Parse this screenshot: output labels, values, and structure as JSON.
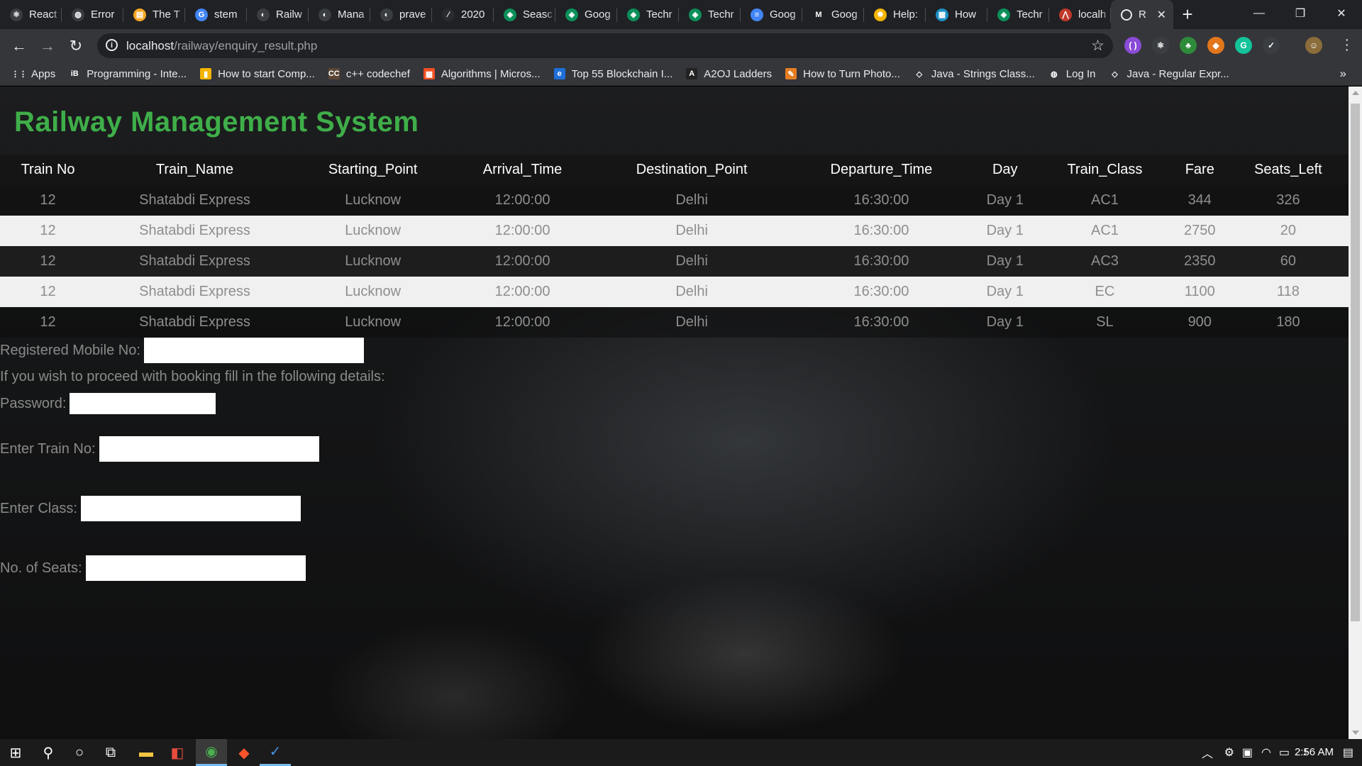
{
  "browser": {
    "tabs": [
      {
        "title": "React",
        "color": "#3a3d42",
        "glyph": "⚛"
      },
      {
        "title": "Error",
        "color": "#3a3d42",
        "glyph": "◍"
      },
      {
        "title": "The T",
        "color": "#f6a623",
        "glyph": "▤"
      },
      {
        "title": "stem",
        "color": "#4285f4",
        "glyph": "G"
      },
      {
        "title": "Railw",
        "color": "#3a3d42",
        "glyph": "◐"
      },
      {
        "title": "Mana",
        "color": "#3a3d42",
        "glyph": "◐"
      },
      {
        "title": "prave",
        "color": "#3a3d42",
        "glyph": "◐"
      },
      {
        "title": "2020",
        "color": "#2a2b2e",
        "glyph": "∕"
      },
      {
        "title": "Seasc",
        "color": "#0a8f5a",
        "glyph": "◈"
      },
      {
        "title": "Goog",
        "color": "#0a8f5a",
        "glyph": "◈"
      },
      {
        "title": "Techr",
        "color": "#0a8f5a",
        "glyph": "◈"
      },
      {
        "title": "Techr",
        "color": "#0a8f5a",
        "glyph": "◈"
      },
      {
        "title": "Goog",
        "color": "#4285f4",
        "glyph": "≡"
      },
      {
        "title": "Goog",
        "color": "#202124",
        "glyph": "M"
      },
      {
        "title": "Help:",
        "color": "#f4b400",
        "glyph": "✹"
      },
      {
        "title": "How",
        "color": "#1e90c8",
        "glyph": "▦"
      },
      {
        "title": "Techr",
        "color": "#0a8f5a",
        "glyph": "◈"
      },
      {
        "title": "localh",
        "color": "#c0392b",
        "glyph": "⋀"
      }
    ],
    "active_tab": {
      "title": "R",
      "close": "✕"
    },
    "new_tab": "+",
    "window_controls": {
      "minimize": "—",
      "restore": "❐",
      "close": "✕"
    },
    "nav": {
      "back": "←",
      "forward": "→",
      "reload": "↻"
    },
    "url": {
      "host": "localhost",
      "path": "/railway/enquiry_result.php"
    },
    "bookmark_star": "☆",
    "extensions": [
      {
        "name": "bracket-extension-icon",
        "glyph": "( )",
        "color": "#8a4bd6"
      },
      {
        "name": "react-devtools-icon",
        "glyph": "⚛",
        "color": "#3a3d42"
      },
      {
        "name": "tree-extension-icon",
        "glyph": "♣",
        "color": "#2e8b3a"
      },
      {
        "name": "metamask-icon",
        "glyph": "◆",
        "color": "#e2761b"
      },
      {
        "name": "grammarly-icon",
        "glyph": "G",
        "color": "#15c39a"
      },
      {
        "name": "task-checker-icon",
        "glyph": "✓",
        "color": "#3a3d42"
      },
      {
        "name": "profile-avatar",
        "glyph": "☺",
        "color": "#8a6d3b"
      }
    ],
    "bookmarks": [
      {
        "label": "Apps",
        "glyph": "⋮⋮",
        "color": "#35363a"
      },
      {
        "label": "Programming - Inte...",
        "glyph": "iB",
        "color": "#35363a"
      },
      {
        "label": "How to start Comp...",
        "glyph": "▮",
        "color": "#f4b400"
      },
      {
        "label": "c++ codechef",
        "glyph": "CC",
        "color": "#5b4636"
      },
      {
        "label": "Algorithms | Micros...",
        "glyph": "▦",
        "color": "#f25022"
      },
      {
        "label": "Top 55 Blockchain I...",
        "glyph": "e",
        "color": "#1e6fd9"
      },
      {
        "label": "A2OJ Ladders",
        "glyph": "A",
        "color": "#222"
      },
      {
        "label": "How to Turn Photo...",
        "glyph": "✎",
        "color": "#e67e22"
      },
      {
        "label": "Java - Strings Class...",
        "glyph": "◇",
        "color": "#35363a"
      },
      {
        "label": "Log In",
        "glyph": "◍",
        "color": "#35363a"
      },
      {
        "label": "Java - Regular Expr...",
        "glyph": "◇",
        "color": "#35363a"
      }
    ],
    "bookmarks_more": "»"
  },
  "page": {
    "title": "Railway Management System",
    "table": {
      "headers": [
        "Train No",
        "Train_Name",
        "Starting_Point",
        "Arrival_Time",
        "Destination_Point",
        "Departure_Time",
        "Day",
        "Train_Class",
        "Fare",
        "Seats_Left"
      ],
      "rows": [
        [
          "12",
          "Shatabdi Express",
          "Lucknow",
          "12:00:00",
          "Delhi",
          "16:30:00",
          "Day 1",
          "AC1",
          "344",
          "326"
        ],
        [
          "12",
          "Shatabdi Express",
          "Lucknow",
          "12:00:00",
          "Delhi",
          "16:30:00",
          "Day 1",
          "AC1",
          "2750",
          "20"
        ],
        [
          "12",
          "Shatabdi Express",
          "Lucknow",
          "12:00:00",
          "Delhi",
          "16:30:00",
          "Day 1",
          "AC3",
          "2350",
          "60"
        ],
        [
          "12",
          "Shatabdi Express",
          "Lucknow",
          "12:00:00",
          "Delhi",
          "16:30:00",
          "Day 1",
          "EC",
          "1100",
          "118"
        ],
        [
          "12",
          "Shatabdi Express",
          "Lucknow",
          "12:00:00",
          "Delhi",
          "16:30:00",
          "Day 1",
          "SL",
          "900",
          "180"
        ]
      ]
    },
    "booking_intro": "If you wish to proceed with booking fill in the following details:",
    "form": {
      "mobile_label": "Registered Mobile No:",
      "mobile_value": "",
      "password_label": "Password:",
      "password_value": "",
      "train_label": "Enter Train No:",
      "train_value": "",
      "class_label": "Enter Class:",
      "class_value": "",
      "seats_label": "No. of Seats:",
      "seats_value": ""
    }
  },
  "taskbar": {
    "start": "⊞",
    "search": "⚲",
    "cortana": "○",
    "task_view": "⧉",
    "apps": [
      {
        "name": "file-explorer-icon",
        "glyph": "▬",
        "color": "#f4c542"
      },
      {
        "name": "office-icon",
        "glyph": "◧",
        "color": "#e74c3c"
      },
      {
        "name": "chrome-icon",
        "glyph": "◉",
        "color": "#4caf50"
      },
      {
        "name": "brave-icon",
        "glyph": "◆",
        "color": "#fb542b"
      },
      {
        "name": "task-app-icon",
        "glyph": "✓",
        "color": "#4a90e2"
      }
    ],
    "tray": {
      "chevron": "︿",
      "time": "2:56 AM",
      "notifications": "▤"
    }
  }
}
